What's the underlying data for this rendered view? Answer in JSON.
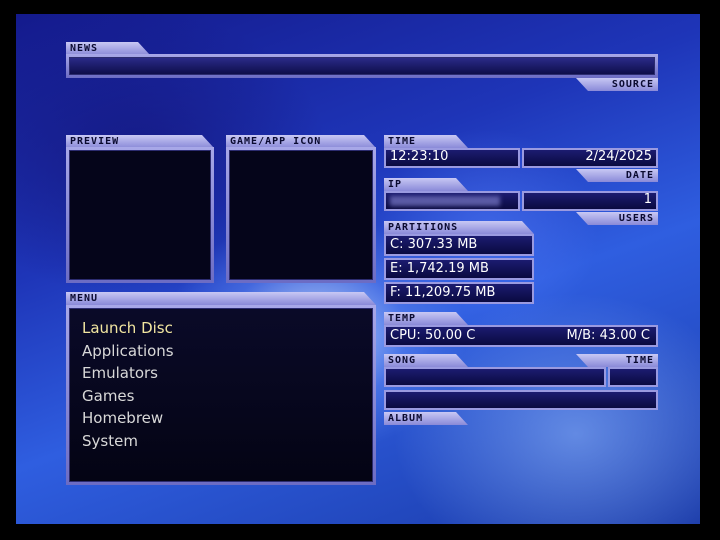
{
  "labels": {
    "news": "NEWS",
    "source": "SOURCE",
    "preview": "PREVIEW",
    "game_icon": "GAME/APP ICON",
    "time": "TIME",
    "date": "DATE",
    "ip": "IP",
    "users": "USERS",
    "partitions": "PARTITIONS",
    "menu": "MENU",
    "temp": "TEMP",
    "song": "SONG",
    "song_time": "TIME",
    "album": "ALBUM"
  },
  "clock": {
    "time": "12:23:10",
    "date": "2/24/2025"
  },
  "network": {
    "users": "1"
  },
  "partitions": [
    "C: 307.33 MB",
    "E: 1,742.19 MB",
    "F: 11,209.75 MB"
  ],
  "temp": {
    "cpu": "CPU: 50.00 C",
    "mb": "M/B: 43.00 C"
  },
  "menu": {
    "selected_index": 0,
    "items": [
      "Launch Disc",
      "Applications",
      "Emulators",
      "Games",
      "Homebrew",
      "System"
    ]
  },
  "colors": {
    "selected_text": "#f2e6a0",
    "text": "#d8d8d8",
    "panel_frame": "#9a9ae0"
  }
}
